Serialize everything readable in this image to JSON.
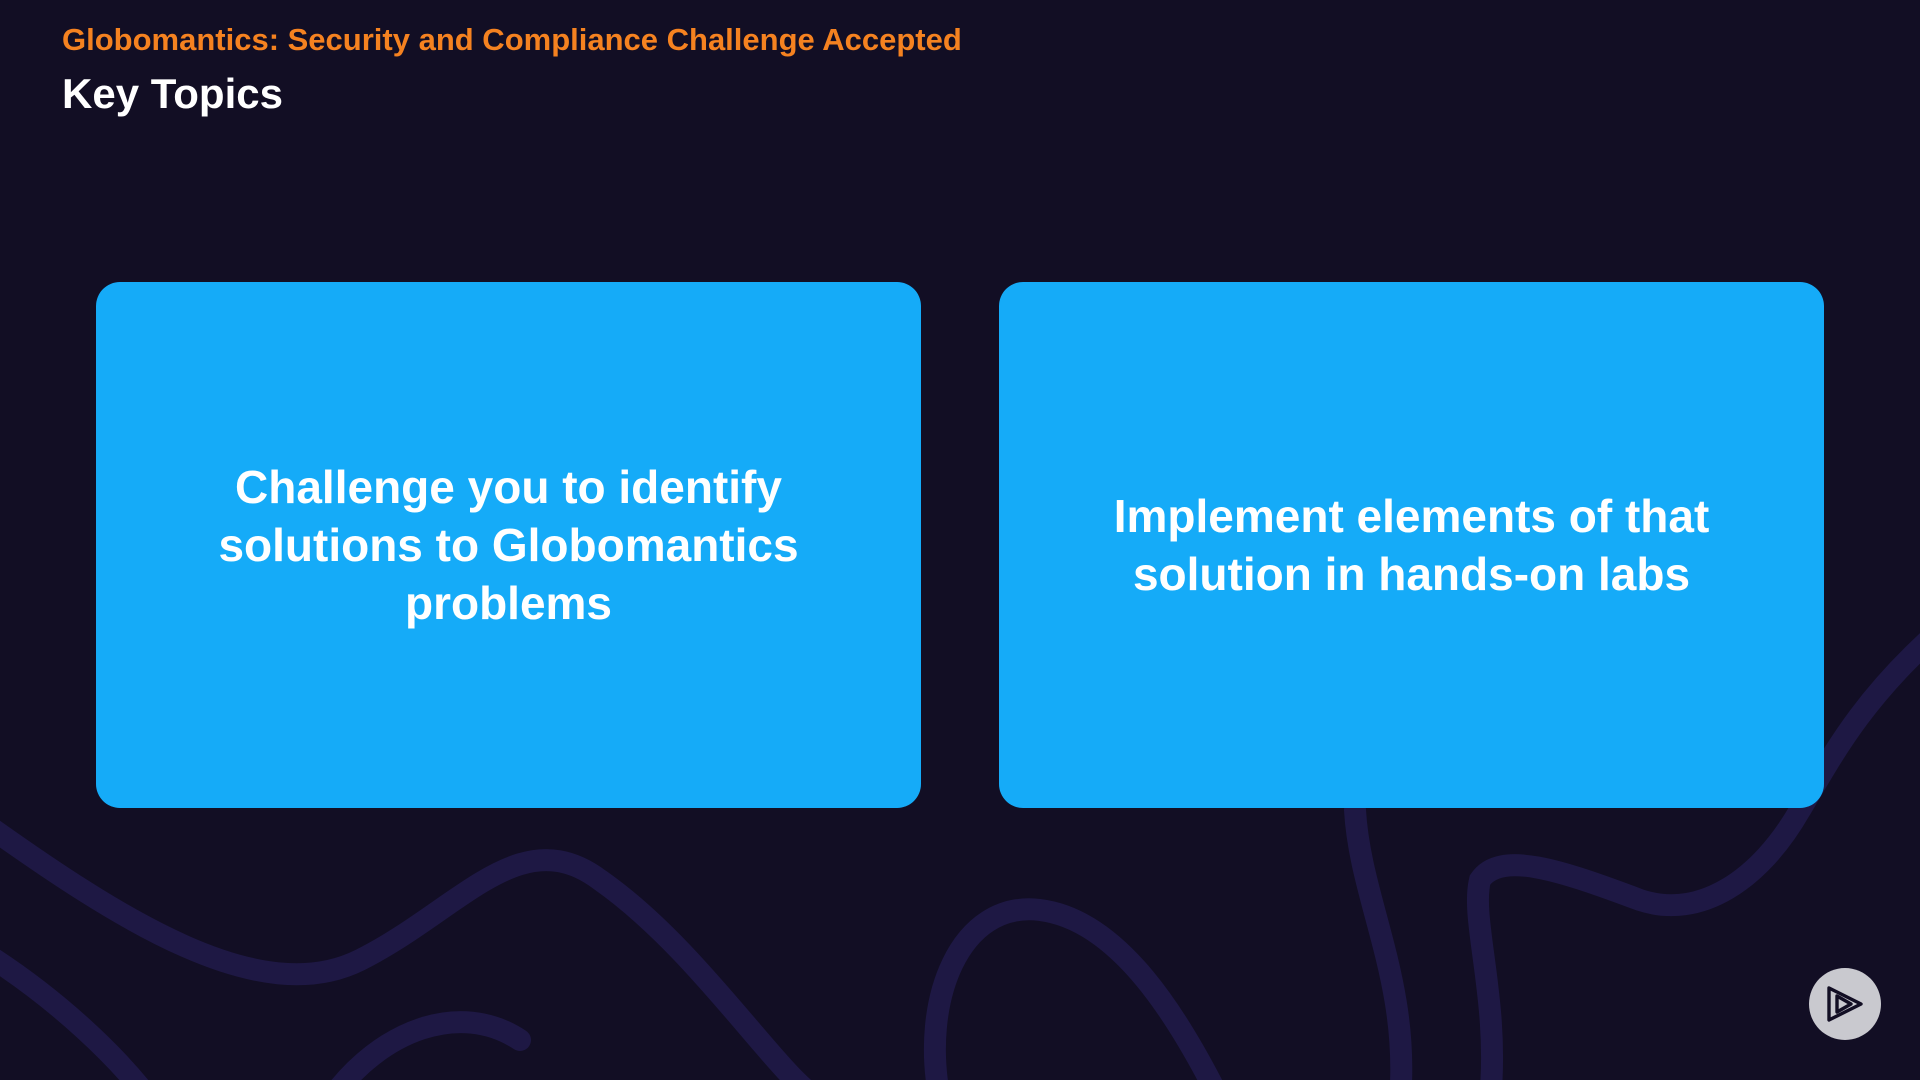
{
  "header": {
    "course_title": "Globomantics: Security and Compliance Challenge Accepted",
    "slide_title": "Key Topics"
  },
  "cards": [
    {
      "text": "Challenge you to identify solutions to Globomantics problems"
    },
    {
      "text": "Implement elements of that solution in hands-on labs"
    }
  ],
  "colors": {
    "background": "#120e24",
    "accent_orange": "#f58220",
    "card_blue": "#15abf8",
    "curve": "#1e1844"
  },
  "icons": {
    "logo": "play-logo-icon"
  }
}
